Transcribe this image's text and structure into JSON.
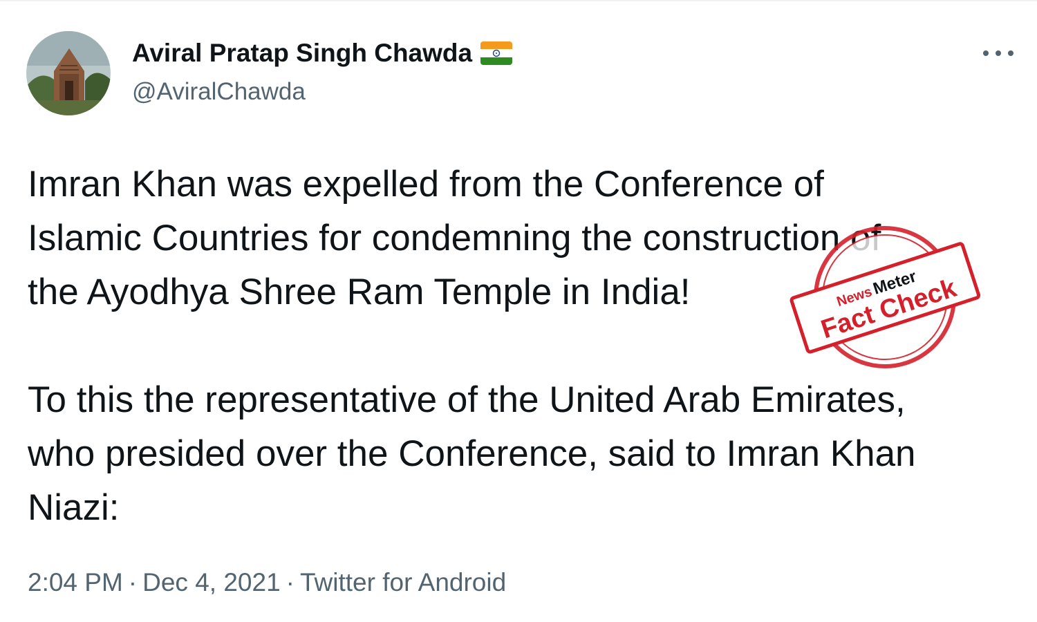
{
  "tweet": {
    "author": {
      "display_name": "Aviral Pratap Singh Chawda",
      "handle": "@AviralChawda",
      "flag_icon": "india-flag-icon"
    },
    "text_paragraphs": [
      "Imran Khan was expelled from the Conference of\nIslamic Countries for condemning the construction of\nthe Ayodhya Shree Ram Temple in India!",
      " To this the representative of the United Arab Emirates,\nwho presided over the Conference, said to Imran Khan\nNiazi:"
    ],
    "time": "2:04 PM",
    "separator": "·",
    "date": "Dec 4, 2021",
    "source": "Twitter for Android",
    "more_icon": "more-horizontal-icon"
  },
  "stamp": {
    "brand_left": "News",
    "brand_right": "Meter",
    "label": "Fact Check",
    "color": "#d4202b"
  },
  "colors": {
    "text": "#0f1419",
    "secondary": "#536471"
  }
}
